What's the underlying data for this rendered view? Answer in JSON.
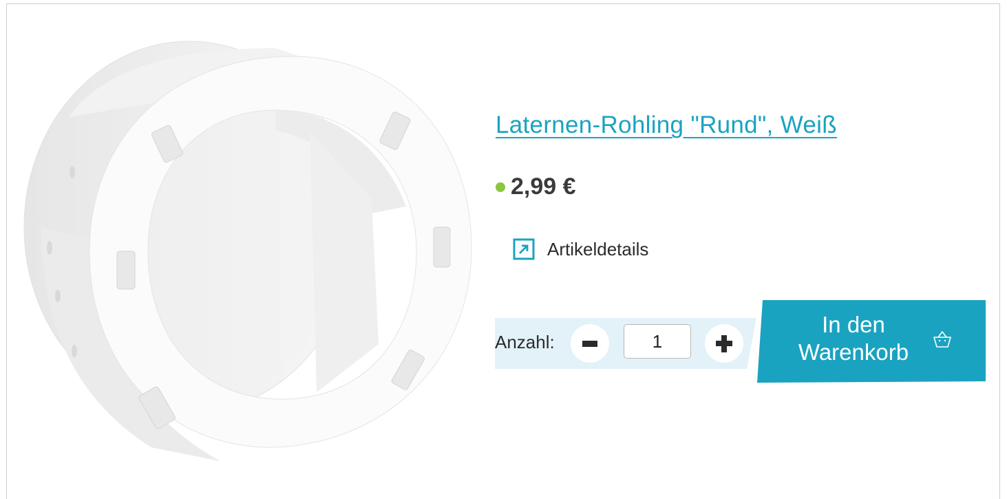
{
  "product": {
    "title": "Laternen-Rohling \"Rund\", Weiß",
    "price": "2,99 €",
    "availability_color": "#8cc63f",
    "image_alt": "Laternen-Rohling Rund, Weiß"
  },
  "details": {
    "label": "Artikeldetails",
    "icon": "external-link-arrow-icon"
  },
  "quantity": {
    "label": "Anzahl:",
    "value": "1",
    "decrement_icon": "minus-icon",
    "increment_icon": "plus-icon"
  },
  "cart": {
    "label_line1": "In den",
    "label_line2": "Warenkorb",
    "icon": "basket-icon"
  },
  "colors": {
    "accent": "#1aa3c0",
    "panel": "#e3f2f8",
    "text": "#2b2b2b"
  }
}
